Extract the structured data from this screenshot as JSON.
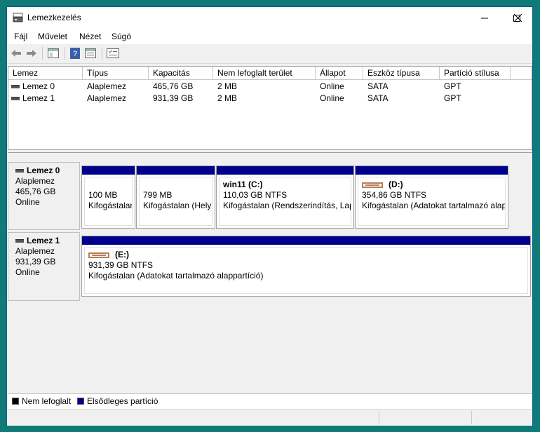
{
  "window": {
    "title": "Lemezkezelés"
  },
  "icons": {
    "app": "disk-management-icon",
    "minimize": "minimize-icon",
    "maximize": "maximize-icon",
    "close": "close-icon",
    "back": "arrow-left-icon",
    "forward": "arrow-right-icon",
    "properties": "properties-icon",
    "help": "help-icon",
    "console": "console-icon",
    "list": "list-icon",
    "disk": "disk-icon",
    "drive": "drive-icon"
  },
  "menu": {
    "items": [
      "Fájl",
      "Művelet",
      "Nézet",
      "Súgó"
    ]
  },
  "volume_list": {
    "columns": [
      "Lemez",
      "Típus",
      "Kapacitás",
      "Nem lefoglalt terület",
      "Állapot",
      "Eszköz típusa",
      "Partíció stílusa"
    ],
    "rows": [
      [
        "Lemez 0",
        "Alaplemez",
        "465,76 GB",
        "2 MB",
        "Online",
        "SATA",
        "GPT"
      ],
      [
        "Lemez 1",
        "Alaplemez",
        "931,39 GB",
        "2 MB",
        "Online",
        "SATA",
        "GPT"
      ]
    ]
  },
  "disks": [
    {
      "name": "Lemez 0",
      "type": "Alaplemez",
      "size": "465,76 GB",
      "status": "Online",
      "partitions": [
        {
          "title": "",
          "line1": "100 MB",
          "line2": "Kifogástalan"
        },
        {
          "title": "",
          "line1": "799 MB",
          "line2": "Kifogástalan (Hely"
        },
        {
          "title": "win11  (C:)",
          "line1": "110,03 GB NTFS",
          "line2": "Kifogástalan (Rendszerindítás, Lapo"
        },
        {
          "title": "(D:)",
          "line1": "354,86 GB NTFS",
          "line2": "Kifogástalan (Adatokat tartalmazó alap"
        }
      ]
    },
    {
      "name": "Lemez 1",
      "type": "Alaplemez",
      "size": "931,39 GB",
      "status": "Online",
      "partitions": [
        {
          "title": "(E:)",
          "line1": "931,39 GB NTFS",
          "line2": "Kifogástalan (Adatokat tartalmazó alappartíció)"
        }
      ]
    }
  ],
  "legend": [
    {
      "label": "Nem lefoglalt",
      "color": "#000000"
    },
    {
      "label": "Elsődleges partíció",
      "color": "#00008b"
    }
  ],
  "colors": {
    "primary_partition": "#00008b",
    "window_border": "#0a5a8a",
    "desktop": "#0f7a78"
  }
}
